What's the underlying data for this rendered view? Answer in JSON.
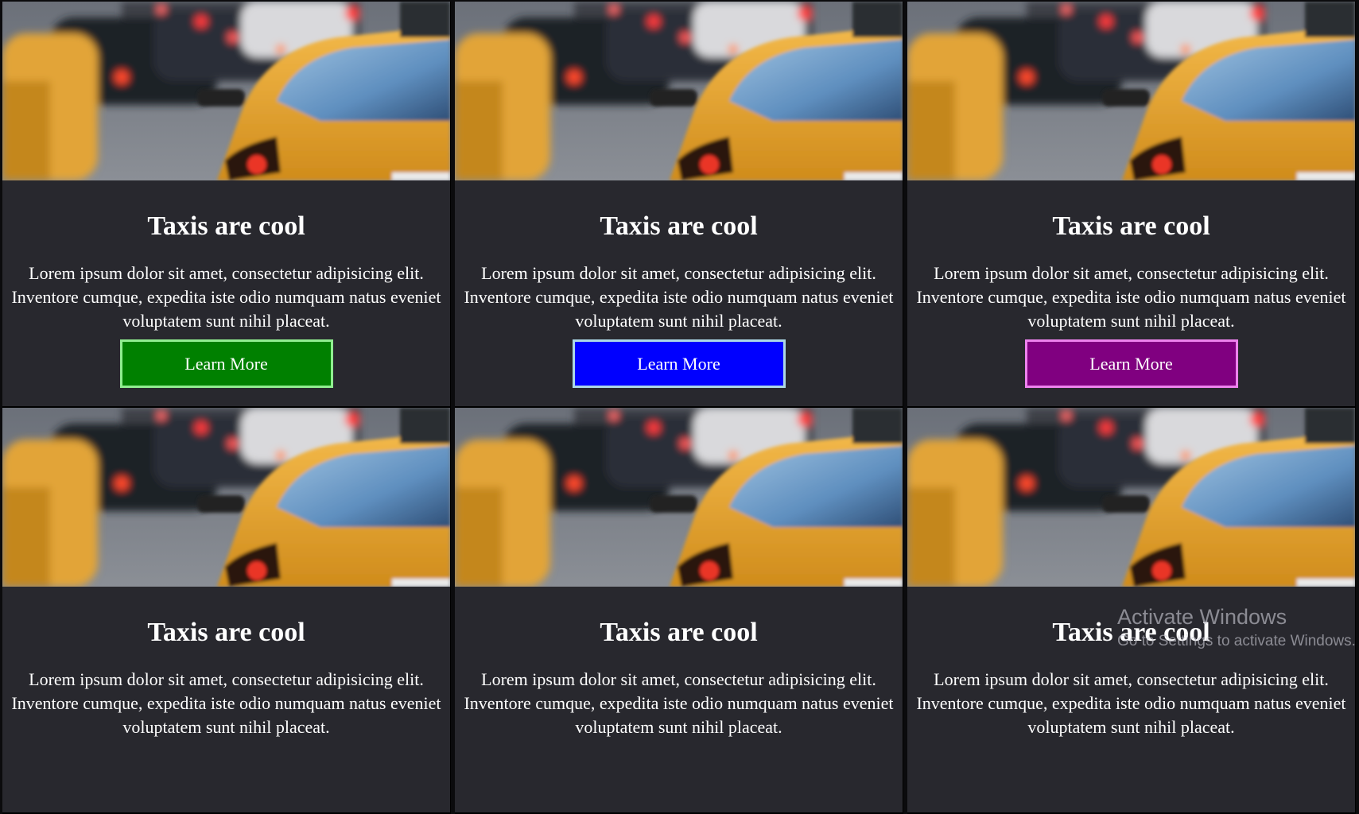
{
  "cards": [
    {
      "title": "Taxis are cool",
      "text": "Lorem ipsum dolor sit amet, consectetur adipisicing elit. Inventore cumque, expedita iste odio numquam natus eveniet voluptatem sunt nihil placeat.",
      "button": {
        "label": "Learn More",
        "bg": "#008000",
        "border": "#90ee90"
      }
    },
    {
      "title": "Taxis are cool",
      "text": "Lorem ipsum dolor sit amet, consectetur adipisicing elit. Inventore cumque, expedita iste odio numquam natus eveniet voluptatem sunt nihil placeat.",
      "button": {
        "label": "Learn More",
        "bg": "#0000ff",
        "border": "#add8e6"
      }
    },
    {
      "title": "Taxis are cool",
      "text": "Lorem ipsum dolor sit amet, consectetur adipisicing elit. Inventore cumque, expedita iste odio numquam natus eveniet voluptatem sunt nihil placeat.",
      "button": {
        "label": "Learn More",
        "bg": "#800080",
        "border": "#ee82ee"
      }
    },
    {
      "title": "Taxis are cool",
      "text": "Lorem ipsum dolor sit amet, consectetur adipisicing elit. Inventore cumque, expedita iste odio numquam natus eveniet voluptatem sunt nihil placeat."
    },
    {
      "title": "Taxis are cool",
      "text": "Lorem ipsum dolor sit amet, consectetur adipisicing elit. Inventore cumque, expedita iste odio numquam natus eveniet voluptatem sunt nihil placeat."
    },
    {
      "title": "Taxis are cool",
      "text": "Lorem ipsum dolor sit amet, consectetur adipisicing elit. Inventore cumque, expedita iste odio numquam natus eveniet voluptatem sunt nihil placeat."
    }
  ],
  "overlay": {
    "activate_title": "Activate Windows",
    "activate_subtitle": "Go to Settings to activate Windows."
  },
  "colors": {
    "card_bg": "#28282e",
    "page_bg": "#0b0b0d",
    "text": "#ffffff"
  }
}
